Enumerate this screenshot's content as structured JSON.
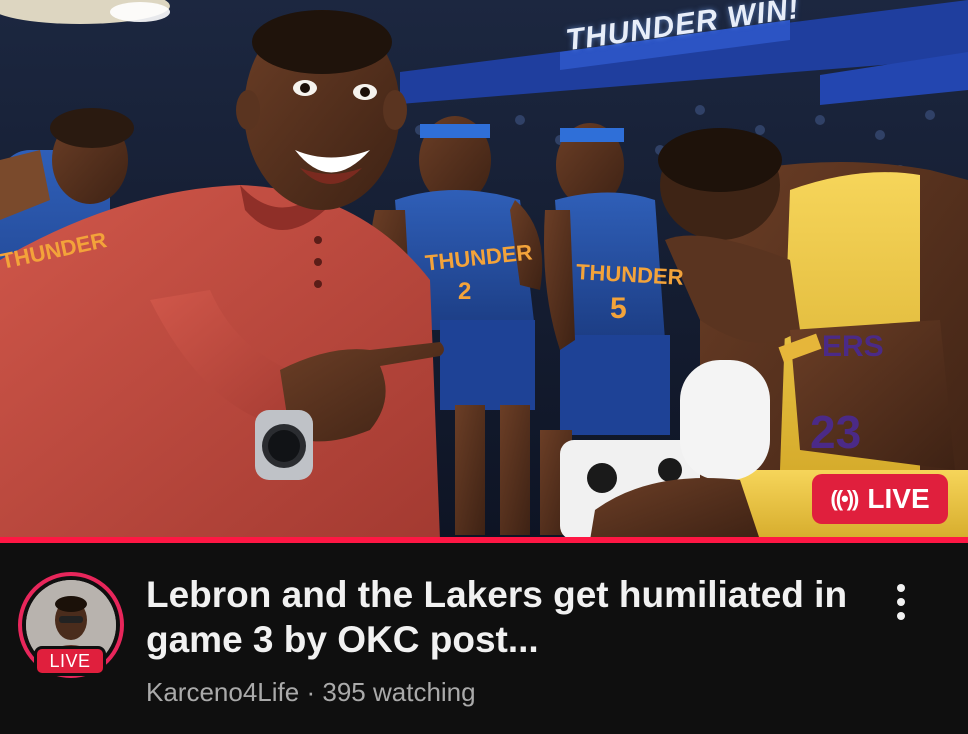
{
  "thumbnail": {
    "banner_text": "THUNDER WIN!",
    "jersey_left": "THUNDER",
    "jersey_center": "THUNDER",
    "jersey_right": "THUNDER",
    "number_center": "2",
    "number_right": "5",
    "number_lebron": "23",
    "lakers_text": "ERS",
    "live_badge": {
      "icon": "radio-waves-icon",
      "label": "LIVE",
      "color": "#e01f3d"
    }
  },
  "progress": {
    "fraction": 1.0,
    "color": "#ff1744"
  },
  "video": {
    "title": "Lebron  and the Lakers get humiliated in game 3 by OKC post...",
    "channel": "Karceno4Life",
    "separator": "·",
    "viewers": "395 watching",
    "avatar_live_label": "LIVE",
    "ring_color": "#e8265b"
  },
  "more_menu": {
    "icon": "vertical-ellipsis-icon"
  }
}
